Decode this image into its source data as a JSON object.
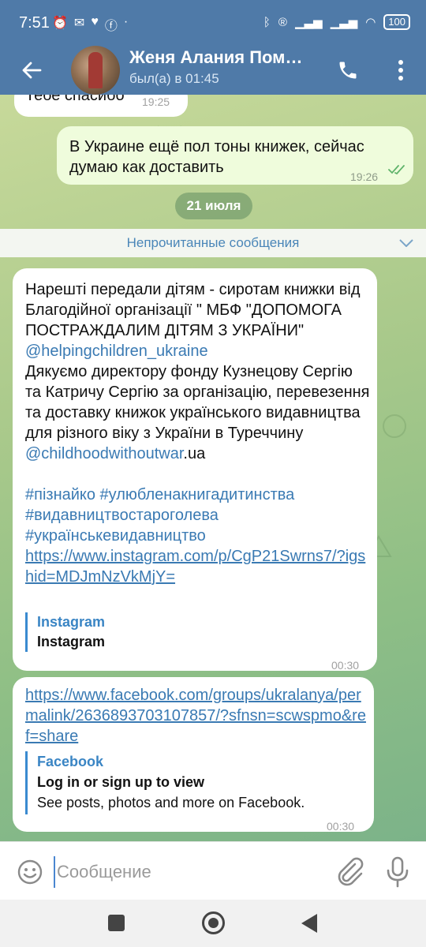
{
  "status_bar": {
    "time": "7:51",
    "battery": "100"
  },
  "header": {
    "contact_name": "Женя Алания Пом…",
    "last_seen": "был(а) в 01:45"
  },
  "messages": [
    {
      "direction": "in",
      "text": "Тебе спасибо",
      "time": "19:25"
    },
    {
      "direction": "out",
      "text": "В Украине ещё пол тоны книжек, сейчас думаю как доставить",
      "time": "19:26"
    }
  ],
  "date_separator": "21 июля",
  "unread_label": "Непрочитанные сообщения",
  "message3": {
    "line1": "Нарешті передали дітям - сиротам книжки від Благодійної організації \" МБФ \"ДОПОМОГА ПОСТРАЖДАЛИМ ДІТЯМ З УКРАЇНИ\" ",
    "mention1": "@helpingchildren_ukraine",
    "line2": "Дякуємо директору фонду Кузнецову Сергію та Катричу Сергію за організацію, перевезення та доставку книжок українського видавництва для різного віку з України в Туреччину ",
    "mention2": "@childhoodwithoutwar",
    "mention2_suffix": ".ua",
    "hashtags1": "#пізнайко #улюбленакнигадитинства",
    "hashtags2": "#видавництвостароголева",
    "hashtags3": "#українськевидавництво",
    "url": "https://www.instagram.com/p/CgP21Swrns7/?igshid=MDJmNzVkMjY=",
    "preview_site": "Instagram",
    "preview_title": "Instagram",
    "time": "00:30"
  },
  "message4": {
    "url": "https://www.facebook.com/groups/ukralanya/permalink/2636893703107857/?sfnsn=scwspmo&ref=share",
    "preview_site": "Facebook",
    "preview_title": "Log in or sign up to view",
    "preview_desc": "See posts, photos and more on Facebook.",
    "time": "00:30"
  },
  "input": {
    "placeholder": "Сообщение",
    "value": ""
  },
  "colors": {
    "header": "#4f7aa8",
    "outgoing_bubble": "#effcdc",
    "link": "#3a7ab3"
  },
  "icons": {
    "back": "arrow-left-icon",
    "call": "phone-icon",
    "menu": "more-vertical-icon",
    "emoji": "smiley-icon",
    "attach": "paperclip-icon",
    "mic": "microphone-icon"
  }
}
